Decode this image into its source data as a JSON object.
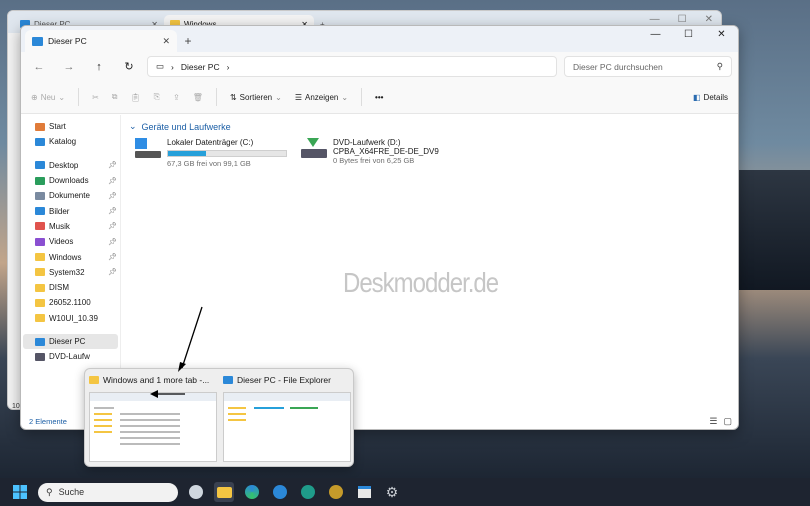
{
  "back_window": {
    "tabs": [
      {
        "label": "Dieser PC"
      },
      {
        "label": "Windows"
      }
    ],
    "side_glyphs": [
      "10"
    ]
  },
  "window": {
    "tab_label": "Dieser PC",
    "new_tab": "+",
    "controls": {
      "minimize": "—",
      "maximize": "☐",
      "close": "✕"
    }
  },
  "address": {
    "path": "Dieser PC",
    "search_placeholder": "Dieser PC durchsuchen"
  },
  "commands": {
    "new_label": "Neu",
    "sort_label": "Sortieren",
    "view_label": "Anzeigen",
    "more_label": "•••",
    "details_label": "Details"
  },
  "nav": {
    "items": [
      {
        "label": "Start",
        "icon": "home-icon"
      },
      {
        "label": "Katalog",
        "icon": "gallery-icon"
      },
      {
        "label": "Desktop",
        "icon": "desktop-icon",
        "pinned": true
      },
      {
        "label": "Downloads",
        "icon": "download-icon",
        "pinned": true
      },
      {
        "label": "Dokumente",
        "icon": "document-icon",
        "pinned": true
      },
      {
        "label": "Bilder",
        "icon": "pictures-icon",
        "pinned": true
      },
      {
        "label": "Musik",
        "icon": "music-icon",
        "pinned": true
      },
      {
        "label": "Videos",
        "icon": "video-icon",
        "pinned": true
      },
      {
        "label": "Windows",
        "icon": "folder-icon",
        "pinned": true
      },
      {
        "label": "System32",
        "icon": "folder-icon",
        "pinned": true
      },
      {
        "label": "DISM",
        "icon": "folder-icon"
      },
      {
        "label": "26052.1100",
        "icon": "folder-icon"
      },
      {
        "label": "W10UI_10.39",
        "icon": "folder-icon"
      },
      {
        "label": "Dieser PC",
        "icon": "pc-icon",
        "selected": true
      },
      {
        "label": "DVD-Laufw",
        "icon": "dvd-icon"
      }
    ]
  },
  "content": {
    "group_label": "Geräte und Laufwerke",
    "drives": [
      {
        "name": "Lokaler Datenträger (C:)",
        "subtitle": "67,3 GB frei von 99,1 GB",
        "used_fraction": 0.32
      },
      {
        "name": "DVD-Laufwerk (D:)",
        "name2": "CPBA_X64FRE_DE-DE_DV9",
        "subtitle": "0 Bytes frei von 6,25 GB"
      }
    ],
    "watermark": "Deskmodder.de"
  },
  "status": {
    "items_count": "2 Elemente"
  },
  "preview": {
    "windows_title": "Windows and 1 more tab -...",
    "pc_title": "Dieser PC - File Explorer"
  },
  "taskbar": {
    "search_label": "Suche"
  },
  "colors": {
    "accent": "#26a0da",
    "link": "#1c5fa6",
    "folder": "#f4c542",
    "taskbar": "#1e2430"
  }
}
